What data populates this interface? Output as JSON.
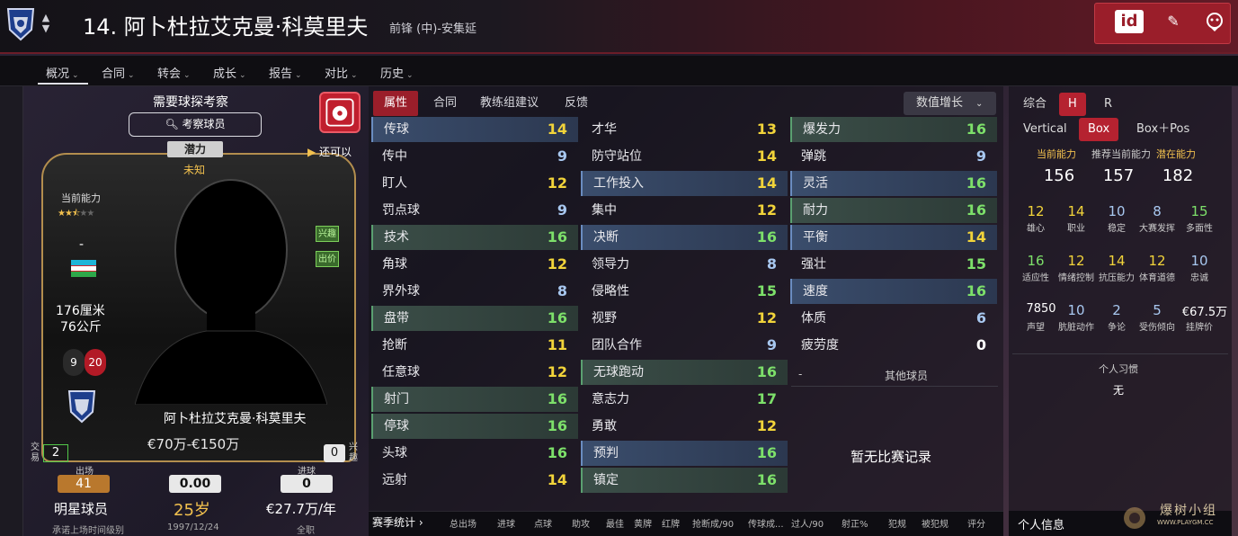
{
  "header": {
    "title": "14. 阿卜杜拉艾克曼·科莫里夫",
    "subtitle": "前锋 (中)-安集延",
    "id_label": "id"
  },
  "nav": [
    {
      "label": "概况"
    },
    {
      "label": "合同"
    },
    {
      "label": "转会"
    },
    {
      "label": "成长"
    },
    {
      "label": "报告"
    },
    {
      "label": "对比"
    },
    {
      "label": "历史"
    }
  ],
  "card": {
    "scout_title": "需要球探考察",
    "scout_button": "考察球员",
    "potential_tag": "潜力",
    "potential_value": "未知",
    "also_can": "还可以",
    "current_ability_label": "当前能力",
    "current_ability_stars": 2.5,
    "position_dash": "-",
    "height": "176厘米",
    "weight": "76公斤",
    "number_a": "9",
    "number_b": "20",
    "tag_interest": "兴趣",
    "tag_bid": "出价",
    "name": "阿卜杜拉艾克曼·科莫里夫",
    "value": "€70万-€150万",
    "trade_label": "交易",
    "trade_value": "2",
    "interest_label": "兴趣",
    "interest_value": "0",
    "apps_label": "出场",
    "apps_value": "41",
    "rating_value": "0.00",
    "goals_label": "进球",
    "goals_value": "0",
    "role": "明星球员",
    "role_sub": "承诺上场时间级别",
    "age": "25岁",
    "dob": "1997/12/24",
    "wage": "€27.7万/年",
    "wage_sub": "全职"
  },
  "tabs": {
    "items": [
      "属性",
      "合同",
      "教练组建议",
      "反馈"
    ],
    "active": "属性",
    "sort_label": "数值增长"
  },
  "attributes": {
    "col1": [
      {
        "name": "传球",
        "value": "14",
        "color": "yellow",
        "hl": "blue"
      },
      {
        "name": "传中",
        "value": "9",
        "color": "blue",
        "hl": ""
      },
      {
        "name": "盯人",
        "value": "12",
        "color": "yellow",
        "hl": ""
      },
      {
        "name": "罚点球",
        "value": "9",
        "color": "blue",
        "hl": ""
      },
      {
        "name": "技术",
        "value": "16",
        "color": "green",
        "hl": "green"
      },
      {
        "name": "角球",
        "value": "12",
        "color": "yellow",
        "hl": ""
      },
      {
        "name": "界外球",
        "value": "8",
        "color": "blue",
        "hl": ""
      },
      {
        "name": "盘带",
        "value": "16",
        "color": "green",
        "hl": "green"
      },
      {
        "name": "抢断",
        "value": "11",
        "color": "yellow",
        "hl": ""
      },
      {
        "name": "任意球",
        "value": "12",
        "color": "yellow",
        "hl": ""
      },
      {
        "name": "射门",
        "value": "16",
        "color": "green",
        "hl": "green"
      },
      {
        "name": "停球",
        "value": "16",
        "color": "green",
        "hl": "green"
      },
      {
        "name": "头球",
        "value": "16",
        "color": "green",
        "hl": ""
      },
      {
        "name": "远射",
        "value": "14",
        "color": "yellow",
        "hl": ""
      }
    ],
    "col2": [
      {
        "name": "才华",
        "value": "13",
        "color": "yellow",
        "hl": ""
      },
      {
        "name": "防守站位",
        "value": "14",
        "color": "yellow",
        "hl": ""
      },
      {
        "name": "工作投入",
        "value": "14",
        "color": "yellow",
        "hl": "blue"
      },
      {
        "name": "集中",
        "value": "12",
        "color": "yellow",
        "hl": ""
      },
      {
        "name": "决断",
        "value": "16",
        "color": "green",
        "hl": "blue"
      },
      {
        "name": "领导力",
        "value": "8",
        "color": "blue",
        "hl": ""
      },
      {
        "name": "侵略性",
        "value": "15",
        "color": "green",
        "hl": ""
      },
      {
        "name": "视野",
        "value": "12",
        "color": "yellow",
        "hl": ""
      },
      {
        "name": "团队合作",
        "value": "9",
        "color": "blue",
        "hl": ""
      },
      {
        "name": "无球跑动",
        "value": "16",
        "color": "green",
        "hl": "green"
      },
      {
        "name": "意志力",
        "value": "17",
        "color": "green",
        "hl": ""
      },
      {
        "name": "勇敢",
        "value": "12",
        "color": "yellow",
        "hl": ""
      },
      {
        "name": "预判",
        "value": "16",
        "color": "green",
        "hl": "blue"
      },
      {
        "name": "镇定",
        "value": "16",
        "color": "green",
        "hl": "green"
      }
    ],
    "col3": [
      {
        "name": "爆发力",
        "value": "16",
        "color": "green",
        "hl": "green"
      },
      {
        "name": "弹跳",
        "value": "9",
        "color": "blue",
        "hl": ""
      },
      {
        "name": "灵活",
        "value": "16",
        "color": "green",
        "hl": "blue"
      },
      {
        "name": "耐力",
        "value": "16",
        "color": "green",
        "hl": "green"
      },
      {
        "name": "平衡",
        "value": "14",
        "color": "yellow",
        "hl": "blue"
      },
      {
        "name": "强壮",
        "value": "15",
        "color": "green",
        "hl": ""
      },
      {
        "name": "速度",
        "value": "16",
        "color": "green",
        "hl": "blue"
      },
      {
        "name": "体质",
        "value": "6",
        "color": "blue",
        "hl": ""
      },
      {
        "name": "疲劳度",
        "value": "0",
        "color": "white",
        "hl": ""
      }
    ],
    "other_dash": "-",
    "other_players": "其他球员",
    "no_record": "暂无比赛记录"
  },
  "season": {
    "title": "赛季统计",
    "headers": [
      "总出场",
      "进球",
      "点球",
      "助攻",
      "最佳",
      "黄牌",
      "红牌",
      "抢断成/90",
      "传球成...",
      "过人/90",
      "射正%",
      "犯规",
      "被犯规",
      "评分"
    ]
  },
  "right": {
    "tab_row1": [
      "综合",
      "H",
      "R"
    ],
    "tab_row1_active": "H",
    "tab_row2": [
      "Vertical",
      "Box",
      "Box＋Pos"
    ],
    "tab_row2_active": "Box",
    "ability_labels": [
      "当前能力",
      "推荐当前能力",
      "潜在能力"
    ],
    "ability_values": [
      "156",
      "157",
      "182"
    ],
    "personality1": [
      {
        "value": "12",
        "label": "雄心",
        "color": "yellow"
      },
      {
        "value": "14",
        "label": "职业",
        "color": "yellow"
      },
      {
        "value": "10",
        "label": "稳定",
        "color": "blue"
      },
      {
        "value": "8",
        "label": "大赛发挥",
        "color": "blue"
      },
      {
        "value": "15",
        "label": "多面性",
        "color": "green"
      }
    ],
    "personality2": [
      {
        "value": "16",
        "label": "适应性",
        "color": "green"
      },
      {
        "value": "12",
        "label": "情绪控制",
        "color": "yellow"
      },
      {
        "value": "14",
        "label": "抗压能力",
        "color": "yellow"
      },
      {
        "value": "12",
        "label": "体育道德",
        "color": "yellow"
      },
      {
        "value": "10",
        "label": "忠诚",
        "color": "blue"
      }
    ],
    "personality3": [
      {
        "value": "7850",
        "label": "声望",
        "color": "white"
      },
      {
        "value": "10",
        "label": "肮脏动作",
        "color": "blue"
      },
      {
        "value": "2",
        "label": "争论",
        "color": "blue"
      },
      {
        "value": "5",
        "label": "受伤倾向",
        "color": "blue"
      },
      {
        "value": "€67.5万",
        "label": "挂牌价",
        "color": "white"
      }
    ],
    "habit_title": "个人习惯",
    "habit_value": "无",
    "info_title": "个人信息"
  },
  "watermark": {
    "text": "爆树小组",
    "sub": "WWW.PLAYGM.CC"
  },
  "colors": {
    "accent": "#9a1e2a",
    "yellow": "#f2d43a",
    "green": "#7de06a",
    "blue": "#a8c8f0"
  }
}
